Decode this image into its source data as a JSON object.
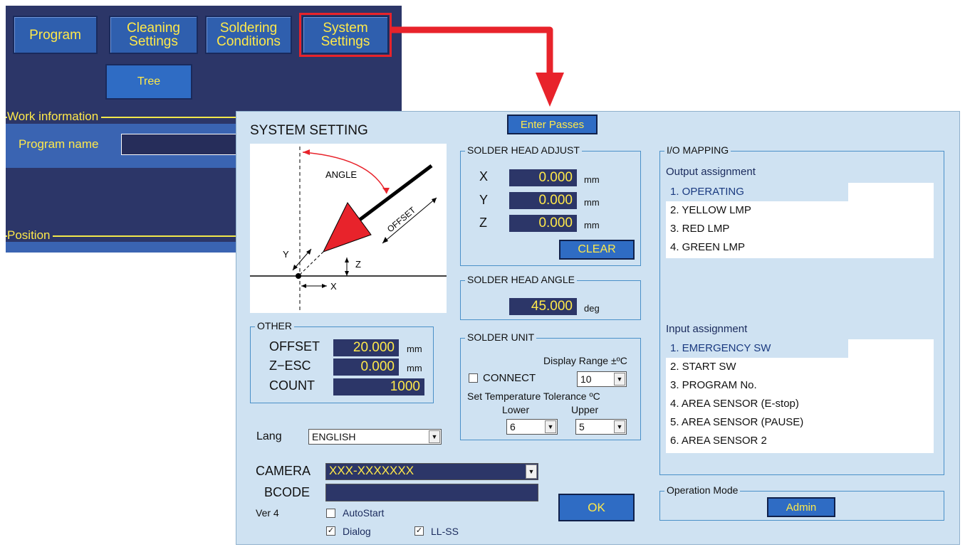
{
  "main_tabs": [
    {
      "label_line1": "Program",
      "label_line2": ""
    },
    {
      "label_line1": "Cleaning",
      "label_line2": "Settings"
    },
    {
      "label_line1": "Soldering",
      "label_line2": "Conditions"
    },
    {
      "label_line1": "System",
      "label_line2": "Settings"
    }
  ],
  "tree_button": "Tree",
  "work_information": {
    "title": "Work information",
    "program_name_label": "Program name",
    "program_name_value": ""
  },
  "position_title": "Position",
  "dialog": {
    "title": "SYSTEM SETTING",
    "enter_passes": "Enter Passes",
    "diagram": {
      "angle": "ANGLE",
      "offset": "OFFSET",
      "x": "X",
      "y": "Y",
      "z": "Z"
    },
    "solder_head_adjust": {
      "title": "SOLDER HEAD ADJUST",
      "rows": [
        {
          "axis": "X",
          "value": "0.000",
          "unit": "mm"
        },
        {
          "axis": "Y",
          "value": "0.000",
          "unit": "mm"
        },
        {
          "axis": "Z",
          "value": "0.000",
          "unit": "mm"
        }
      ],
      "clear": "CLEAR"
    },
    "solder_head_angle": {
      "title": "SOLDER HEAD ANGLE",
      "value": "45.000",
      "unit": "deg"
    },
    "other": {
      "title": "OTHER",
      "rows": [
        {
          "label": "OFFSET",
          "value": "20.000",
          "unit": "mm"
        },
        {
          "label": "Z−ESC",
          "value": "0.000",
          "unit": "mm"
        },
        {
          "label": "COUNT",
          "value": "1000",
          "unit": ""
        }
      ]
    },
    "solder_unit": {
      "title": "SOLDER UNIT",
      "display_range_label": "Display Range ±ºC",
      "connect_label": "CONNECT",
      "connect_checked": false,
      "display_range_value": "10",
      "tolerance_label": "Set Temperature Tolerance ºC",
      "lower_label": "Lower",
      "upper_label": "Upper",
      "lower_value": "6",
      "upper_value": "5"
    },
    "lang": {
      "label": "Lang",
      "value": "ENGLISH"
    },
    "camera": {
      "label": "CAMERA",
      "value": "XXX-XXXXXXX"
    },
    "bcode": {
      "label": "BCODE",
      "value": ""
    },
    "version": "Ver 4",
    "autostart": {
      "label": "AutoStart",
      "checked": false
    },
    "dialog_opt": {
      "label": "Dialog",
      "checked": true
    },
    "llss": {
      "label": "LL-SS",
      "checked": true
    },
    "ok": "OK",
    "io_mapping": {
      "title": "I/O MAPPING",
      "output_label": "Output assignment",
      "outputs": [
        "1. OPERATING",
        "2. YELLOW LMP",
        "3. RED LMP",
        "4. GREEN LMP"
      ],
      "input_label": "Input assignment",
      "inputs": [
        "1. EMERGENCY SW",
        "2. START SW",
        "3. PROGRAM No.",
        "4. AREA SENSOR (E-stop)",
        "5. AREA SENSOR (PAUSE)",
        "6. AREA SENSOR 2"
      ]
    },
    "operation_mode": {
      "title": "Operation Mode",
      "value": "Admin"
    }
  },
  "colors": {
    "accent_red": "#e8232b",
    "panel_blue": "#2c3668",
    "dialog_bg": "#cfe2f2",
    "label_yellow": "#ffe94a"
  }
}
